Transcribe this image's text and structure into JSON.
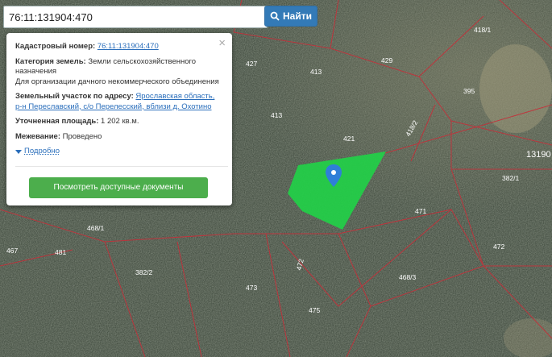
{
  "search": {
    "value": "76:11:131904:470",
    "button_label": "Найти",
    "button_icon": "search-icon"
  },
  "popup": {
    "cadastral_label": "Кадастровый номер:",
    "cadastral_value": "76:11:131904:470",
    "category_label": "Категория земель:",
    "category_value": "Земли сельскохозяйственного назначения",
    "category_use": "Для организации дачного некоммерческого объединения",
    "address_label": "Земельный участок по адресу:",
    "address_line1": "Ярославская область,",
    "address_line2": "р-н Переславский, с/о Перелесский, вблизи д. Охотино",
    "area_label": "Уточненная площадь:",
    "area_value": "1 202 кв.м.",
    "survey_label": "Межевание:",
    "survey_value": "Проведено",
    "more_label": "Подробно",
    "docs_button": "Посмотреть доступные документы",
    "close_icon": "close-icon"
  },
  "map": {
    "parcel_labels": [
      "418/1",
      "427",
      "429",
      "413",
      "395",
      "413",
      "421",
      "418/2",
      "13190",
      "382/1",
      "471",
      "468/1",
      "467",
      "481",
      "472",
      "382/2",
      "472",
      "468/3",
      "473",
      "475"
    ],
    "colors": {
      "parcel_fill": "#22d048",
      "boundary": "#c4303a",
      "marker": "#2f7fd8"
    }
  }
}
